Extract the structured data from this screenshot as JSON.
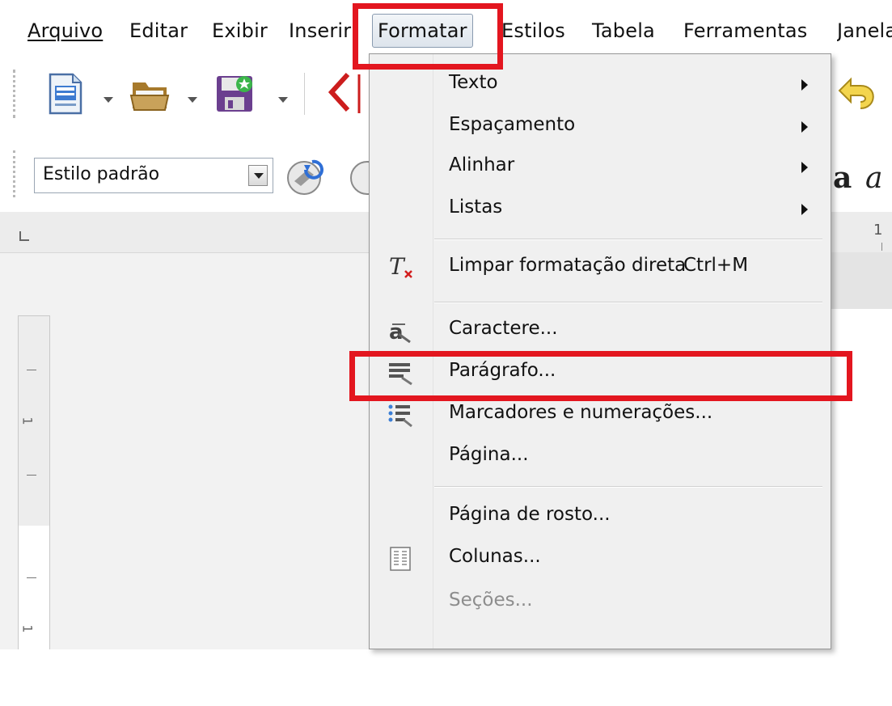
{
  "menubar": {
    "items": [
      {
        "label": "Arquivo"
      },
      {
        "label": "Editar"
      },
      {
        "label": "Exibir"
      },
      {
        "label": "Inserir"
      },
      {
        "label": "Formatar"
      },
      {
        "label": "Estilos"
      },
      {
        "label": "Tabela"
      },
      {
        "label": "Ferramentas"
      },
      {
        "label": "Janela"
      }
    ]
  },
  "toolbar": {
    "paragraph_style": "Estilo padrão"
  },
  "ruler": {
    "top_number": "1",
    "left_number": "1"
  },
  "format_menu": {
    "items": [
      {
        "label": "Texto"
      },
      {
        "label": "Espaçamento"
      },
      {
        "label": "Alinhar"
      },
      {
        "label": "Listas"
      },
      {
        "label": "Limpar formatação direta",
        "shortcut": "Ctrl+M"
      },
      {
        "label": "Caractere..."
      },
      {
        "label": "Parágrafo..."
      },
      {
        "label": "Marcadores e numerações..."
      },
      {
        "label": "Página..."
      },
      {
        "label": "Página de rosto..."
      },
      {
        "label": "Colunas..."
      },
      {
        "label": "Seções...",
        "disabled": true
      }
    ]
  },
  "highlight_color": "#e3161f",
  "accent_colors": {
    "menu_bg": "#f0f0f0",
    "toolbar_bg": "#ffffff"
  }
}
